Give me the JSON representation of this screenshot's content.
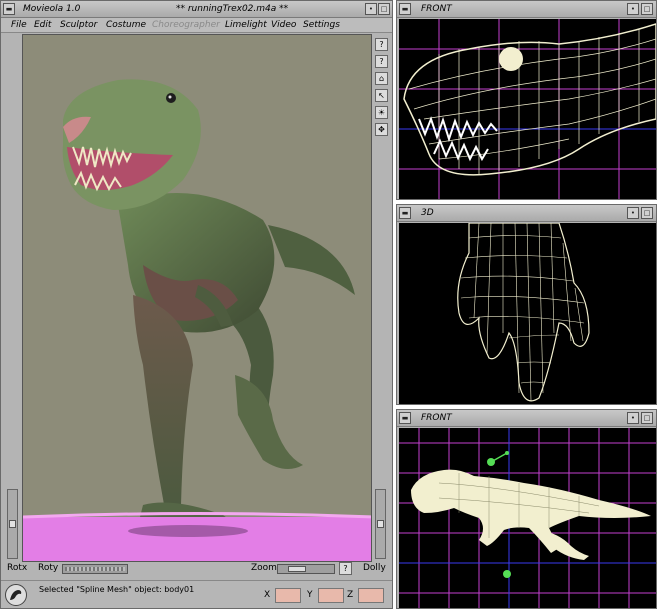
{
  "main": {
    "app_title": "Movieola 1.0",
    "file_title": "** runningTrex02.m4a **",
    "menu": [
      {
        "label": "File",
        "disabled": false
      },
      {
        "label": "Edit",
        "disabled": false
      },
      {
        "label": "Sculptor",
        "disabled": false
      },
      {
        "label": "Costume",
        "disabled": false
      },
      {
        "label": "Choreographer",
        "disabled": true
      },
      {
        "label": "Limelight",
        "disabled": false
      },
      {
        "label": "Video",
        "disabled": false
      },
      {
        "label": "Settings",
        "disabled": false
      }
    ],
    "controls": {
      "rotx": "Rotx",
      "roty": "Roty",
      "zoom": "Zoom",
      "zoom_help": "?",
      "dolly": "Dolly"
    },
    "status_text": "Selected \"Spline Mesh\" object: body01",
    "coords": {
      "x": "X",
      "y": "Y",
      "z": "Z"
    }
  },
  "views": [
    {
      "title": "FRONT"
    },
    {
      "title": "3D"
    },
    {
      "title": "FRONT"
    }
  ],
  "colors": {
    "viewport_bg": "#8d8c79",
    "floor": "#e37ee6",
    "wire": "#f2efcf",
    "grid": "#c43fd0",
    "axis": "#3a3af0"
  }
}
